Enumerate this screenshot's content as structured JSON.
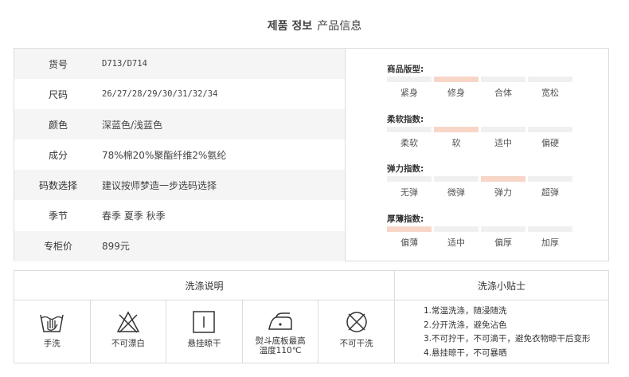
{
  "header": {
    "title_ko": "제품 정보",
    "title_cn": "产品信息"
  },
  "info_rows": [
    {
      "label": "货号",
      "value": "D713/D714",
      "mono": true
    },
    {
      "label": "尺码",
      "value": "26/27/28/29/30/31/32/34",
      "mono": true
    },
    {
      "label": "颜色",
      "value": "深蓝色/浅蓝色",
      "mono": false
    },
    {
      "label": "成分",
      "value": "78%棉20%聚酯纤维2%氨纶",
      "mono": false
    },
    {
      "label": "码数选择",
      "value": "建议按师梦造一步选码选择",
      "mono": false
    },
    {
      "label": "季节",
      "value": "春季 夏季 秋季",
      "mono": false
    },
    {
      "label": "专柜价",
      "value": "899元",
      "mono": false
    }
  ],
  "attributes": [
    {
      "title": "商品版型:",
      "options": [
        "紧身",
        "修身",
        "合体",
        "宽松"
      ],
      "selected_index": 1
    },
    {
      "title": "柔软指数:",
      "options": [
        "柔软",
        "软",
        "适中",
        "偏硬"
      ],
      "selected_index": 1
    },
    {
      "title": "弹力指数:",
      "options": [
        "无弹",
        "微弹",
        "弹力",
        "超弹"
      ],
      "selected_index": 2
    },
    {
      "title": "厚薄指数:",
      "options": [
        "偏薄",
        "适中",
        "偏厚",
        "加厚"
      ],
      "selected_index": 0
    }
  ],
  "colors": {
    "highlight": "#f7d6c8",
    "bar": "#f0f0f0",
    "border": "#dcdcdc"
  },
  "wash": {
    "heading": "洗涤说明",
    "items": [
      {
        "icon": "hand-wash-icon",
        "caption": "手洗"
      },
      {
        "icon": "no-bleach-icon",
        "caption": "不可漂白"
      },
      {
        "icon": "hang-dry-icon",
        "caption": "悬挂晾干"
      },
      {
        "icon": "iron-icon",
        "caption_line1": "熨斗底板最高",
        "caption_line2": "温度110℃"
      },
      {
        "icon": "no-dry-clean-icon",
        "caption": "不可干洗"
      }
    ]
  },
  "tips": {
    "heading": "洗涤小贴士",
    "lines": [
      "1.常温洗涤，随浸随洗",
      "2.分开洗涤，避免沾色",
      "3.不可拧干，不可滴干，避免衣物晾干后变形",
      "4.悬挂晾干，不可暴晒"
    ]
  }
}
